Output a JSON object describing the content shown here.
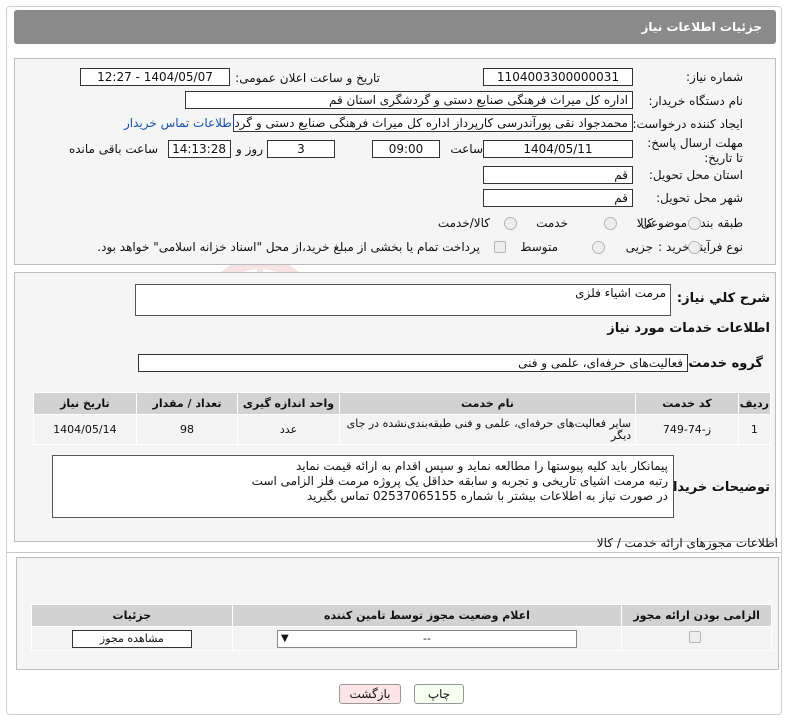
{
  "header": {
    "title": "جزئیات اطلاعات نیاز"
  },
  "form": {
    "need_number_label": "شماره نیاز:",
    "need_number": "1104003300000031",
    "announce_label": "تاریخ و ساعت اعلان عمومی:",
    "announce_value": "1404/05/07 - 12:27",
    "buyer_org_label": "نام دستگاه خریدار:",
    "buyer_org": "اداره کل میراث فرهنگی  صنایع دستی و گردشگری استان قم",
    "creator_label": "ایجاد کننده درخواست:",
    "creator": "محمدجواد نقی پورآندرسی کارپرداز اداره کل میراث فرهنگی  صنایع دستی و گردشگری",
    "contact_link": "اطلاعات تماس خریدار",
    "deadline_label": "مهلت ارسال پاسخ: تا تاریخ:",
    "deadline_date": "1404/05/11",
    "time_label": "ساعت",
    "deadline_time": "09:00",
    "days_value": "3",
    "days_label": "روز و",
    "remaining_time": "14:13:28",
    "remaining_label": "ساعت باقی مانده",
    "province_label": "استان محل تحویل:",
    "province": "قم",
    "city_label": "شهر محل تحویل:",
    "city": "قم",
    "category_label": "طبقه بندی موضوعی:",
    "category_options": [
      "کالا",
      "خدمت",
      "کالا/خدمت"
    ],
    "process_label": "نوع فرآیند خرید :",
    "process_options": [
      "جزیی",
      "متوسط"
    ],
    "payment_note": "پرداخت تمام یا بخشی از مبلغ خرید،از محل \"اسناد خزانه اسلامی\" خواهد بود."
  },
  "summary": {
    "label": "شرح کلي نياز:",
    "value": "مرمت اشیاء فلزی",
    "services_title": "اطلاعات خدمات مورد نیاز",
    "group_label": "گروه خدمت:",
    "group_value": "فعالیت‌های حرفه‌ای، علمی و فنی"
  },
  "table": {
    "headers": [
      "ردیف",
      "کد خدمت",
      "نام خدمت",
      "واحد اندازه گیری",
      "تعداد / مقدار",
      "تاریخ نیاز"
    ],
    "rows": [
      [
        "1",
        "ز-74-749",
        "سایر فعالیت‌های حرفه‌ای، علمی و فنی طبقه‌بندی‌نشده در جای دیگر",
        "عدد",
        "98",
        "1404/05/14"
      ]
    ]
  },
  "notes": {
    "label": "توضیحات خریدار:",
    "lines": [
      "پیمانکار باید کلیه پیوستها را مطالعه نماید و سپس اقدام به ارائه قیمت نماید",
      "رتبه مرمت اشیای تاریخی و تجربه و سابقه حداقل یک پروژه مرمت فلز الزامی است",
      "در صورت نیاز به اطلاعات بیشتر با شماره 02537065155 تماس بگیرید"
    ]
  },
  "permits": {
    "title": "اطلاعات مجوزهای ارائه خدمت / کالا",
    "headers": [
      "الزامی بودن ارائه مجوز",
      "اعلام وضعیت مجوز توسط تامین کننده",
      "جزئیات"
    ],
    "select_value": "--",
    "view_button": "مشاهده مجوز"
  },
  "buttons": {
    "print": "چاپ",
    "back": "بازگشت"
  },
  "watermark": "AriaTender.neT"
}
